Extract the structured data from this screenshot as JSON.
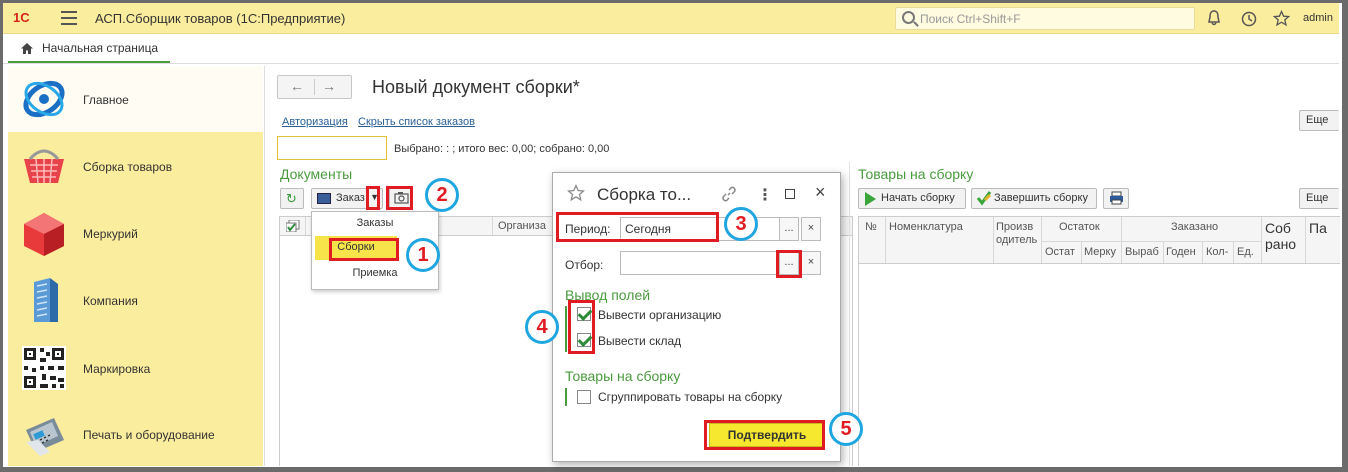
{
  "titlebar": {
    "logo": "1С",
    "title": "АСП.Сборщик товаров  (1С:Предприятие)",
    "search_placeholder": "Поиск Ctrl+Shift+F",
    "user": "admin"
  },
  "tabs": {
    "home": "Начальная страница"
  },
  "sidebar": {
    "items": [
      {
        "label": "Главное"
      },
      {
        "label": "Сборка товаров"
      },
      {
        "label": "Меркурий"
      },
      {
        "label": "Компания"
      },
      {
        "label": "Маркировка"
      },
      {
        "label": "Печать и оборудование"
      }
    ]
  },
  "document": {
    "title": "Новый документ сборки*",
    "link_auth": "Авторизация",
    "link_hide": "Скрыть список заказов",
    "info": "Выбрано: : ; итого вес: 0,00; собрано: 0,00",
    "more_label": "Еще"
  },
  "documents_panel": {
    "title": "Документы",
    "type_select": "Заказ",
    "col_org": "Организа",
    "dropdown": [
      "Заказы",
      "Сборки",
      "Приемка"
    ]
  },
  "goods_panel": {
    "title": "Товары на сборку",
    "btn_start": "Начать сборку",
    "btn_finish": "Завершить сборку",
    "more_label": "Еще",
    "columns": {
      "n": "№",
      "nomenclature": "Номенклатура",
      "producer": "Произв одитель",
      "stock": "Остаток",
      "ordered": "Заказано",
      "collected": "Соб рано",
      "pa": "Па"
    },
    "subcolumns": [
      "Остат",
      "Мерку",
      "Выраб",
      "Годен",
      "Кол-",
      "Ед."
    ]
  },
  "dialog": {
    "title": "Сборка то...",
    "period_label": "Период:",
    "period_value": "Сегодня",
    "filter_label": "Отбор:",
    "filter_value": "",
    "fields_section": "Вывод полей",
    "chk_org": "Вывести организацию",
    "chk_org_checked": true,
    "chk_wh": "Вывести склад",
    "chk_wh_checked": true,
    "goods_section": "Товары на сборку",
    "chk_group": "Сгруппировать товары на сборку",
    "chk_group_checked": false,
    "confirm": "Подтвердить"
  },
  "annotations": [
    "1",
    "2",
    "3",
    "4",
    "5"
  ],
  "colors": {
    "accent_green": "#4a9a3e",
    "titlebar": "#fbed9e",
    "annotation_red": "#e11b22",
    "annotation_blue": "#1fa6e0",
    "confirm_yellow": "#f6e82f"
  }
}
